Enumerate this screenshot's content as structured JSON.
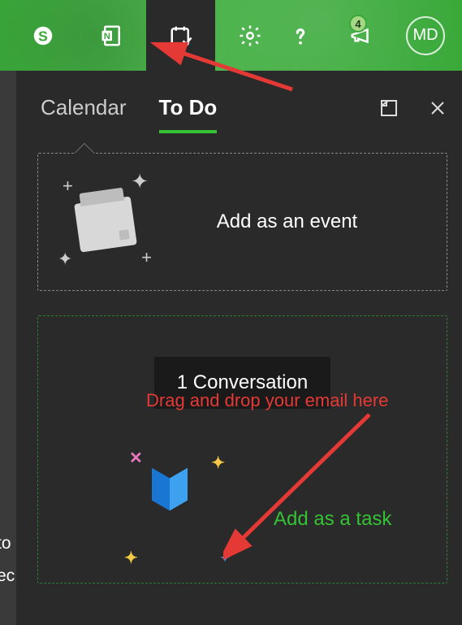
{
  "header": {
    "icons": [
      "skype",
      "onenote",
      "calendar-todo",
      "settings",
      "help",
      "announce"
    ],
    "badge_count": "4",
    "avatar_initials": "MD"
  },
  "panel": {
    "tabs": {
      "calendar": "Calendar",
      "todo": "To Do",
      "active": "todo"
    },
    "event_zone_label": "Add as an event",
    "task_zone_label": "Add as a task",
    "conversation_chip": "1 Conversation"
  },
  "annotations": {
    "drag_hint": "Drag and drop your email here"
  },
  "left_strip": {
    "line1": "to",
    "line2": "ec"
  }
}
